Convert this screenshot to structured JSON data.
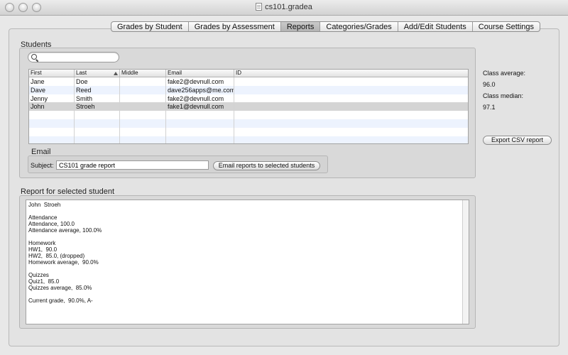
{
  "window": {
    "title": "cs101.gradea"
  },
  "tabs": [
    {
      "label": "Grades by Student"
    },
    {
      "label": "Grades by Assessment"
    },
    {
      "label": "Reports",
      "selected": true
    },
    {
      "label": "Categories/Grades"
    },
    {
      "label": "Add/Edit Students"
    },
    {
      "label": "Course Settings"
    }
  ],
  "students": {
    "group_label": "Students",
    "search": {
      "value": "",
      "placeholder": ""
    },
    "columns": [
      "First",
      "Last",
      "Middle",
      "Email",
      "ID"
    ],
    "sort_column": "Last",
    "rows": [
      {
        "first": "Jane",
        "last": "Doe",
        "middle": "",
        "email": "fake2@devnull.com",
        "id": ""
      },
      {
        "first": "Dave",
        "last": "Reed",
        "middle": "",
        "email": "dave256apps@me.com",
        "id": ""
      },
      {
        "first": "Jenny",
        "last": "Smith",
        "middle": "",
        "email": "fake2@devnull.com",
        "id": ""
      },
      {
        "first": "John",
        "last": "Stroeh",
        "middle": "",
        "email": "fake1@devnull.com",
        "id": ""
      }
    ],
    "selected_row": 3
  },
  "email": {
    "group_label": "Email",
    "subject_label": "Subject:",
    "subject_value": "CS101 grade report",
    "send_button": "Email reports to selected students"
  },
  "stats": {
    "average_label": "Class average:",
    "average_value": "96.0",
    "median_label": "Class median:",
    "median_value": "97.1"
  },
  "export_button": "Export CSV report",
  "report": {
    "group_label": "Report for selected student",
    "lines": [
      "John  Stroeh",
      "",
      "Attendance",
      "Attendance, 100.0",
      "Attendance average, 100.0%",
      "",
      "Homework",
      "HW1,  90.0",
      "HW2,  85.0, (dropped)",
      "Homework average,  90.0%",
      "",
      "Quizzes",
      "Quiz1,  85.0",
      "Quizzes average,  85.0%",
      "",
      "Current grade,  90.0%, A-"
    ]
  }
}
